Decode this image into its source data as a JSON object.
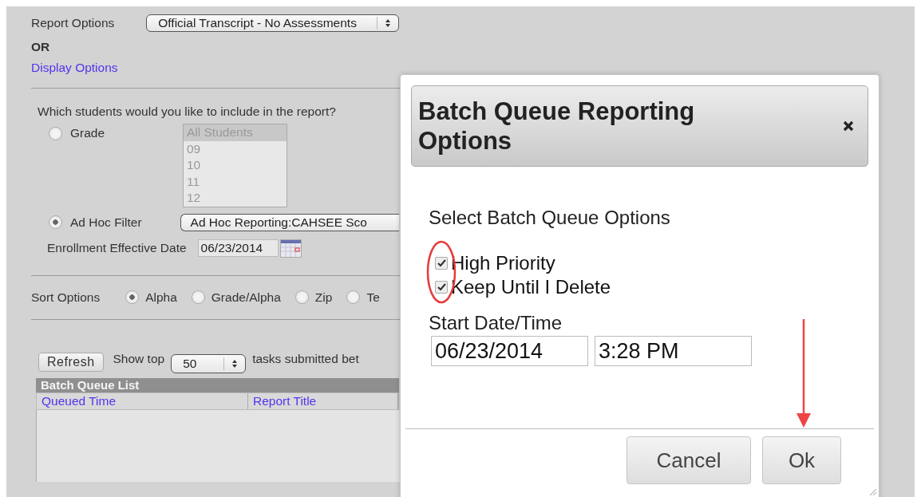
{
  "report_options": {
    "label": "Report Options",
    "value": "Official Transcript - No Assessments"
  },
  "or_label": "OR",
  "display_options_link": "Display Options",
  "students": {
    "question": "Which students would you like to include in the report?",
    "options": [
      {
        "label": "Grade",
        "selected": false,
        "kind": "list"
      },
      {
        "label": "Ad Hoc Filter",
        "selected": true,
        "kind": "select"
      }
    ],
    "grade_list": {
      "disabled": true,
      "items": [
        {
          "label": "All Students",
          "selected": true
        },
        {
          "label": "09",
          "selected": false
        },
        {
          "label": "10",
          "selected": false
        },
        {
          "label": "11",
          "selected": false
        },
        {
          "label": "12",
          "selected": false
        }
      ]
    },
    "ad_hoc_value": "Ad Hoc Reporting:CAHSEE Sco"
  },
  "enrollment": {
    "label": "Enrollment Effective Date",
    "value": "06/23/2014"
  },
  "sort": {
    "label": "Sort Options",
    "options": [
      {
        "label": "Alpha",
        "selected": true
      },
      {
        "label": "Grade/Alpha",
        "selected": false
      },
      {
        "label": "Zip",
        "selected": false
      },
      {
        "label": "Te",
        "selected": false
      }
    ]
  },
  "batch": {
    "refresh": "Refresh",
    "show_top": "Show top",
    "count": "50",
    "suffix": "tasks submitted bet",
    "title": "Batch Queue List",
    "columns": [
      "Queued Time",
      "Report Title"
    ]
  },
  "dialog": {
    "title": "Batch Queue Reporting Options",
    "heading": "Select Batch Queue Options",
    "options": [
      {
        "label": "High Priority",
        "checked": true
      },
      {
        "label": "Keep Until I Delete",
        "checked": true
      }
    ],
    "start_label": "Start Date/Time",
    "date": "06/23/2014",
    "time": "3:28 PM",
    "buttons": [
      {
        "label": "Cancel",
        "kind": "cancel"
      },
      {
        "label": "Ok",
        "kind": "ok"
      }
    ]
  }
}
